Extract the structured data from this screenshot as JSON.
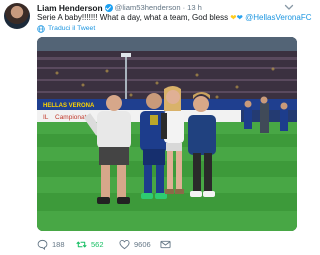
{
  "tweet": {
    "author_name": "Liam Henderson",
    "handle": "@liam53henderson",
    "separator": "·",
    "time": "13 h",
    "text": "Serie A baby!!!!!!! What a day, what a team,  God bless",
    "mention": "@HellasVeronaFC",
    "translate_label": "Traduci il Tweet",
    "heart_colors": [
      "#ffcc1f",
      "#2aa3ef"
    ]
  },
  "media": {
    "banner_left": "HELLAS VERONA",
    "banner_left2": "IL",
    "banner_right": "Campionato",
    "accent": "#2aa3ef"
  },
  "actions": {
    "replies": "188",
    "retweets": "562",
    "likes": "9606"
  },
  "icons": [
    "avatar",
    "verified-badge-icon",
    "chevron-down-icon",
    "globe-icon",
    "reply-icon",
    "retweet-icon",
    "like-icon",
    "message-icon"
  ]
}
